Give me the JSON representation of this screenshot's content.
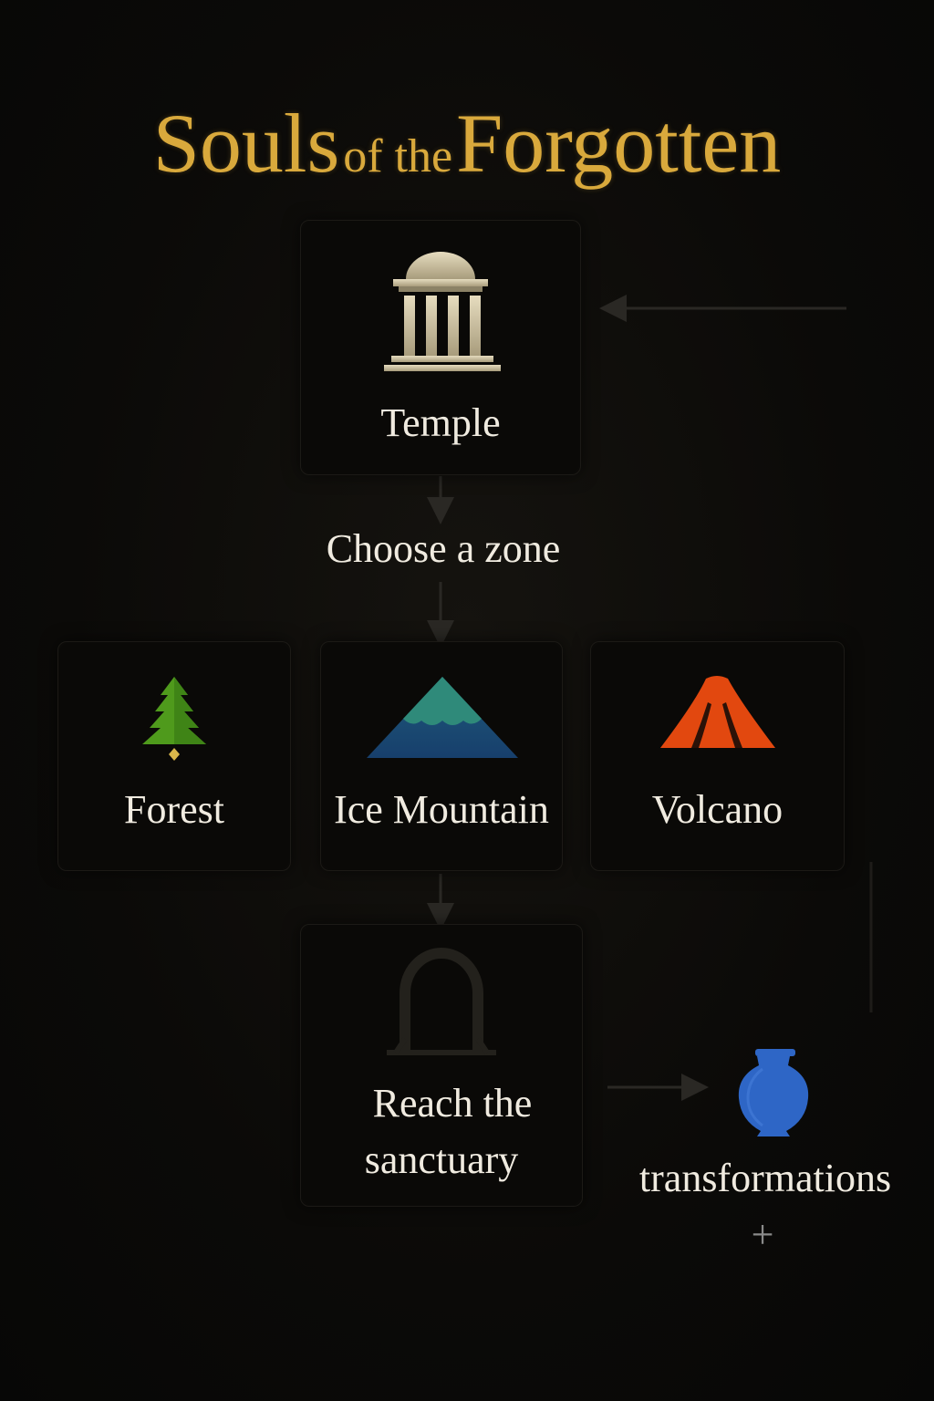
{
  "title": {
    "word1": "Souls",
    "word2": "of the",
    "word3": "Forgotten"
  },
  "temple": {
    "label": "Temple",
    "icon": "temple-icon"
  },
  "choose_zone": {
    "label": "Choose a zone"
  },
  "zones": [
    {
      "label": "Forest",
      "icon": "pine-tree-icon",
      "color": "#4f9a1c"
    },
    {
      "label": "Ice Mountain",
      "icon": "mountain-icon",
      "color": "#2f8a7a"
    },
    {
      "label": "Volcano",
      "icon": "volcano-icon",
      "color": "#e2480f"
    }
  ],
  "sanctuary": {
    "label_line1": "Reach the",
    "label_line2": "sanctuary",
    "icon": "arch-doorway-icon"
  },
  "transformations": {
    "label": "transformations",
    "icon": "urn-icon",
    "plus": "+",
    "color": "#2e66c6"
  },
  "colors": {
    "title_gold": "#d9a93c",
    "background": "#0c0b09",
    "card": "#0a0907",
    "connector": "#2a2824"
  }
}
